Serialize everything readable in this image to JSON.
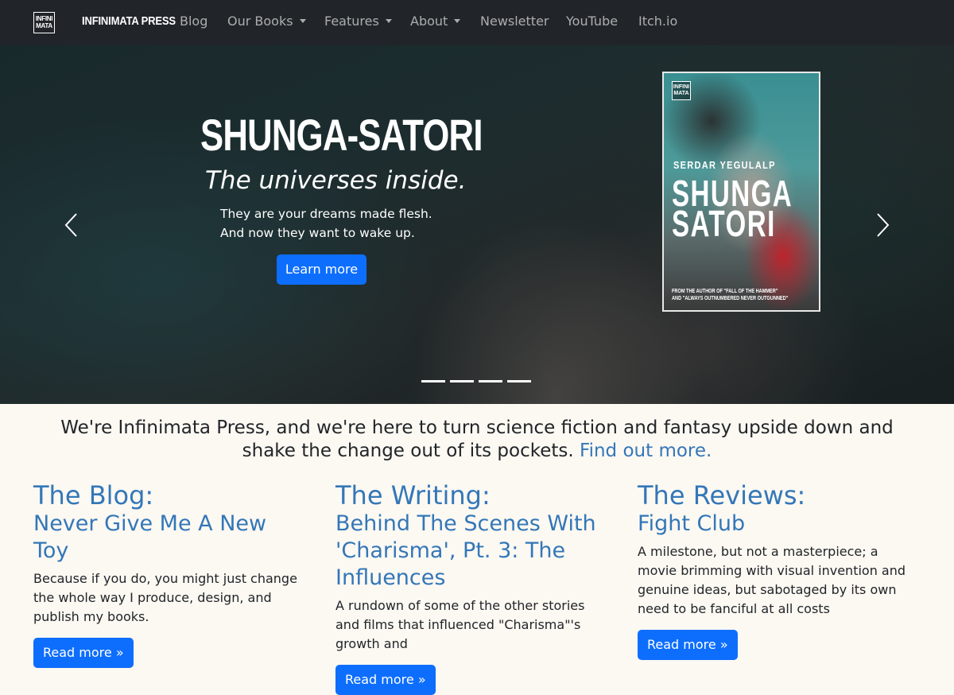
{
  "navbar": {
    "logo_text": "INFINI MATA",
    "brand": "INFINIMATA PRESS",
    "items": [
      {
        "label": "Blog",
        "dropdown": false
      },
      {
        "label": "Our Books",
        "dropdown": true
      },
      {
        "label": "Features",
        "dropdown": true
      },
      {
        "label": "About",
        "dropdown": true
      },
      {
        "label": "Newsletter",
        "dropdown": false
      },
      {
        "label": "YouTube",
        "dropdown": false
      },
      {
        "label": "Itch.io",
        "dropdown": false
      }
    ]
  },
  "hero": {
    "title": "SHUNGA-SATORI",
    "tagline": "The universes inside.",
    "description_line1": "They are your dreams made flesh.",
    "description_line2": "And now they want to wake up.",
    "button_label": "Learn more",
    "prev_icon": "chevron-left-icon",
    "next_icon": "chevron-right-icon",
    "slide_count": 4,
    "cover": {
      "logo_text": "INFINI MATA",
      "author": "SERDAR YEGULALP",
      "title_line1": "SHUNGA",
      "title_line2": "SATORI",
      "credit_line1": "FROM THE AUTHOR OF \"FALL OF THE HAMMER\"",
      "credit_line2": "AND \"ALWAYS OUTNUMBERED NEVER OUTGUNNED\""
    }
  },
  "intro": {
    "text": "We're Infinimata Press, and we're here to turn science fiction and fantasy upside down and shake the change out of its pockets.",
    "link_text": "Find out more."
  },
  "columns": [
    {
      "heading": "The Blog:",
      "subheading": "Never Give Me A New Toy",
      "text": "Because if you do, you might just change the whole way I produce, design, and publish my books.",
      "button_label": "Read more »"
    },
    {
      "heading": "The Writing:",
      "subheading": "Behind The Scenes With 'Charisma', Pt. 3: The Influences",
      "text": "A rundown of some of the other stories and films that influenced \"Charisma\"'s growth and",
      "button_label": "Read more »"
    },
    {
      "heading": "The Reviews:",
      "subheading": "Fight Club",
      "text": "A milestone, but not a masterpiece; a movie brimming with visual invention and genuine ideas, but sabotaged by its own need to be fanciful at all costs",
      "button_label": "Read more »"
    }
  ],
  "colors": {
    "navbar_bg": "#212529",
    "accent_blue": "#0d6efd",
    "link_blue": "#3377b8",
    "page_bg": "#fcf8f2"
  }
}
